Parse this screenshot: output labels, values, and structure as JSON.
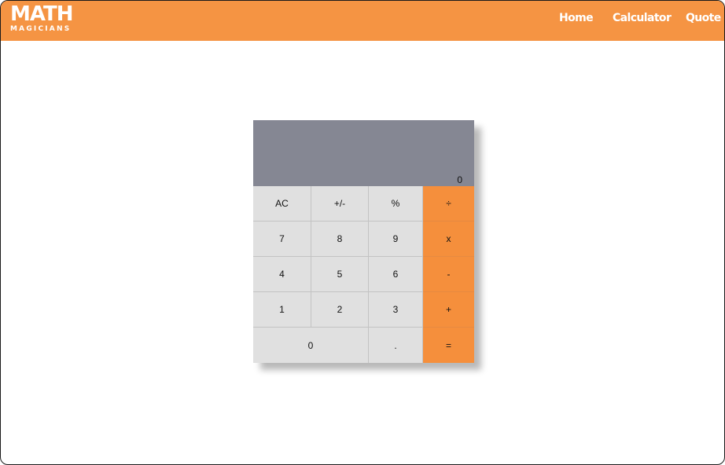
{
  "header": {
    "logo_title": "MATH",
    "logo_subtitle": "MAGICIANS",
    "nav": [
      "Home",
      "Calculator",
      "Quote"
    ]
  },
  "calculator": {
    "display": "0",
    "keys": [
      {
        "label": "AC",
        "type": "function"
      },
      {
        "label": "+/-",
        "type": "function"
      },
      {
        "label": "%",
        "type": "function"
      },
      {
        "label": "÷",
        "type": "operator"
      },
      {
        "label": "7",
        "type": "digit"
      },
      {
        "label": "8",
        "type": "digit"
      },
      {
        "label": "9",
        "type": "digit"
      },
      {
        "label": "x",
        "type": "operator"
      },
      {
        "label": "4",
        "type": "digit"
      },
      {
        "label": "5",
        "type": "digit"
      },
      {
        "label": "6",
        "type": "digit"
      },
      {
        "label": "-",
        "type": "operator"
      },
      {
        "label": "1",
        "type": "digit"
      },
      {
        "label": "2",
        "type": "digit"
      },
      {
        "label": "3",
        "type": "digit"
      },
      {
        "label": "+",
        "type": "operator"
      },
      {
        "label": "0",
        "type": "digit"
      },
      {
        "label": ".",
        "type": "digit"
      },
      {
        "label": "=",
        "type": "operator"
      }
    ]
  },
  "colors": {
    "accent": "#f59443",
    "display_bg": "#858793",
    "key_bg": "#e0e0e0",
    "operator_bg": "#f58f3c"
  }
}
